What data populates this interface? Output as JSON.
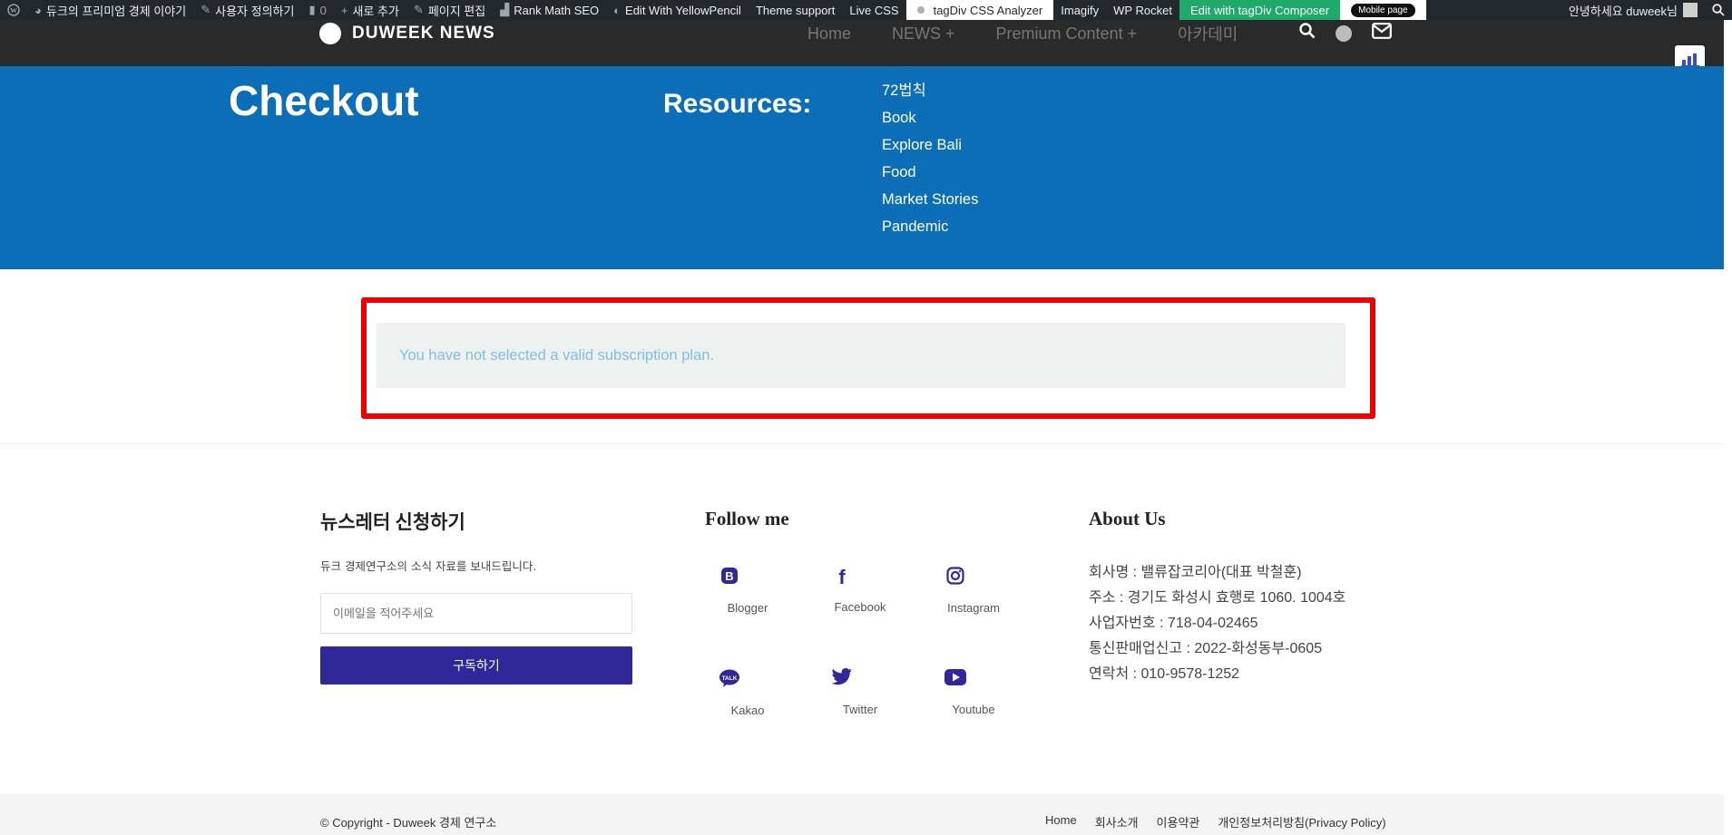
{
  "adminbar": {
    "site_name": "듀크의 프리미엄 경제 이야기",
    "customize": "사용자 정의하기",
    "comments_count": "0",
    "new": "새로 추가",
    "edit_page": "페이지 편집",
    "rank_math": "Rank Math SEO",
    "yellowpencil": "Edit With YellowPencil",
    "theme_support": "Theme support",
    "live_css": "Live CSS",
    "css_analyzer": "tagDiv CSS Analyzer",
    "imagify": "Imagify",
    "wp_rocket": "WP Rocket",
    "composer": "Edit with tagDiv Composer",
    "mobile_page": "Mobile page",
    "greeting": "안녕하세요 duweek님"
  },
  "header": {
    "logo_text": "DUWEEK NEWS",
    "nav": [
      {
        "label": "Home"
      },
      {
        "label": "NEWS  +"
      },
      {
        "label": "Premium Content  +"
      },
      {
        "label": "아카데미"
      }
    ]
  },
  "band": {
    "title": "Checkout",
    "resources_title": "Resources:",
    "resources": [
      "72법칙",
      "Book",
      "Explore Bali",
      "Food",
      "Market Stories",
      "Pandemic"
    ]
  },
  "notice": {
    "message": "You have not selected a valid subscription plan."
  },
  "footer": {
    "newsletter": {
      "title": "뉴스레터 신청하기",
      "description": "듀크 경제연구소의 소식 자료를 보내드립니다.",
      "placeholder": "이메일을 적어주세요",
      "button": "구독하기"
    },
    "follow": {
      "title": "Follow me",
      "items": [
        {
          "label": "Blogger",
          "icon": "blogger-icon"
        },
        {
          "label": "Facebook",
          "icon": "facebook-icon"
        },
        {
          "label": "Instagram",
          "icon": "instagram-icon"
        },
        {
          "label": "Kakao",
          "icon": "kakao-icon"
        },
        {
          "label": "Twitter",
          "icon": "twitter-icon"
        },
        {
          "label": "Youtube",
          "icon": "youtube-icon"
        }
      ]
    },
    "about": {
      "title": "About Us",
      "lines": [
        "회사명 : 밸류잡코리아(대표 박철훈)",
        "주소 : 경기도 화성시 효행로 1060. 1004호",
        "사업자번호 : 718-04-02465",
        "통신판매업신고 : 2022-화성동부-0605",
        "연락처 : 010-9578-1252"
      ]
    },
    "copyright": "© Copyright - Duweek 경제 연구소",
    "links": [
      "Home",
      "회사소개",
      "이용약관",
      "개인정보처리방침(Privacy Policy)"
    ]
  },
  "colors": {
    "brand_blue": "#0b6eb7",
    "button_purple": "#30289a",
    "highlight_red": "#ee0000",
    "notice_text": "#7ec0e4"
  }
}
